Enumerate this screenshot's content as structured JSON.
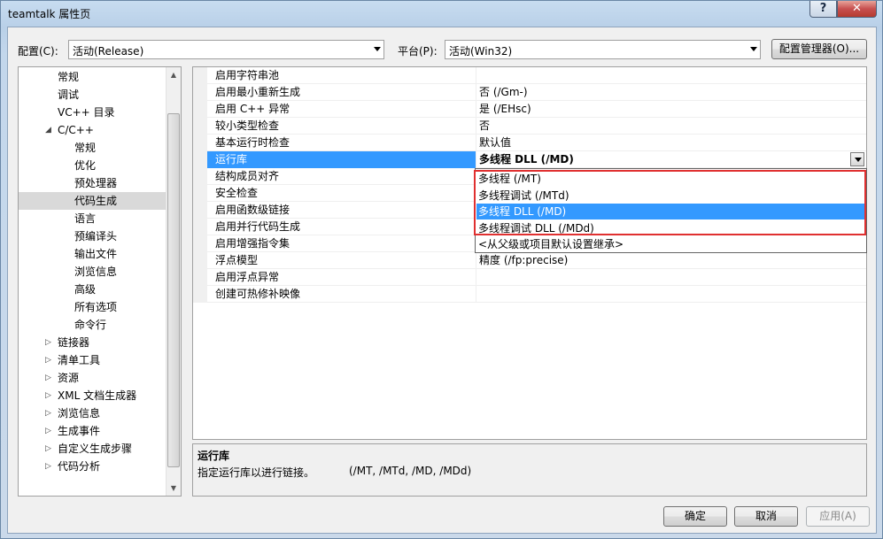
{
  "window": {
    "title": "teamtalk 属性页",
    "help_label": "?",
    "close_label": "✕"
  },
  "toolbar": {
    "config_label": "配置(C):",
    "config_value": "活动(Release)",
    "platform_label": "平台(P):",
    "platform_value": "活动(Win32)",
    "config_manager_label": "配置管理器(O)..."
  },
  "tree": {
    "items": [
      {
        "label": "常规",
        "level": 1
      },
      {
        "label": "调试",
        "level": 1
      },
      {
        "label": "VC++ 目录",
        "level": 1
      },
      {
        "label": "C/C++",
        "level": 1,
        "expander": "◢"
      },
      {
        "label": "常规",
        "level": 2
      },
      {
        "label": "优化",
        "level": 2
      },
      {
        "label": "预处理器",
        "level": 2
      },
      {
        "label": "代码生成",
        "level": 2,
        "selected": true
      },
      {
        "label": "语言",
        "level": 2
      },
      {
        "label": "预编译头",
        "level": 2
      },
      {
        "label": "输出文件",
        "level": 2
      },
      {
        "label": "浏览信息",
        "level": 2
      },
      {
        "label": "高级",
        "level": 2
      },
      {
        "label": "所有选项",
        "level": 2
      },
      {
        "label": "命令行",
        "level": 2
      },
      {
        "label": "链接器",
        "level": 1,
        "expander": "▷"
      },
      {
        "label": "清单工具",
        "level": 1,
        "expander": "▷"
      },
      {
        "label": "资源",
        "level": 1,
        "expander": "▷"
      },
      {
        "label": "XML 文档生成器",
        "level": 1,
        "expander": "▷"
      },
      {
        "label": "浏览信息",
        "level": 1,
        "expander": "▷"
      },
      {
        "label": "生成事件",
        "level": 1,
        "expander": "▷"
      },
      {
        "label": "自定义生成步骤",
        "level": 1,
        "expander": "▷"
      },
      {
        "label": "代码分析",
        "level": 1,
        "expander": "▷"
      }
    ],
    "scroll_up": "▲",
    "scroll_down": "▼"
  },
  "grid": {
    "rows": [
      {
        "name": "启用字符串池",
        "value": ""
      },
      {
        "name": "启用最小重新生成",
        "value": "否 (/Gm-)"
      },
      {
        "name": "启用 C++ 异常",
        "value": "是 (/EHsc)"
      },
      {
        "name": "较小类型检查",
        "value": "否"
      },
      {
        "name": "基本运行时检查",
        "value": "默认值"
      },
      {
        "name": "运行库",
        "value": "多线程 DLL (/MD)",
        "selected": true
      },
      {
        "name": "结构成员对齐",
        "value": ""
      },
      {
        "name": "安全检查",
        "value": ""
      },
      {
        "name": "启用函数级链接",
        "value": ""
      },
      {
        "name": "启用并行代码生成",
        "value": ""
      },
      {
        "name": "启用增强指令集",
        "value": ""
      },
      {
        "name": "浮点模型",
        "value": "精度 (/fp:precise)"
      },
      {
        "name": "启用浮点异常",
        "value": ""
      },
      {
        "name": "创建可热修补映像",
        "value": ""
      }
    ]
  },
  "dropdown": {
    "options": [
      {
        "label": "多线程 (/MT)"
      },
      {
        "label": "多线程调试 (/MTd)"
      },
      {
        "label": "多线程 DLL (/MD)",
        "highlighted": true
      },
      {
        "label": "多线程调试 DLL (/MDd)"
      },
      {
        "label": "<从父级或项目默认设置继承>"
      }
    ]
  },
  "description": {
    "title": "运行库",
    "text": "指定运行库以进行链接。",
    "extra": "(/MT, /MTd, /MD, /MDd)"
  },
  "buttons": {
    "ok": "确定",
    "cancel": "取消",
    "apply": "应用(A)"
  },
  "colors": {
    "selection": "#3399ff",
    "highlight_box": "#e03030"
  }
}
